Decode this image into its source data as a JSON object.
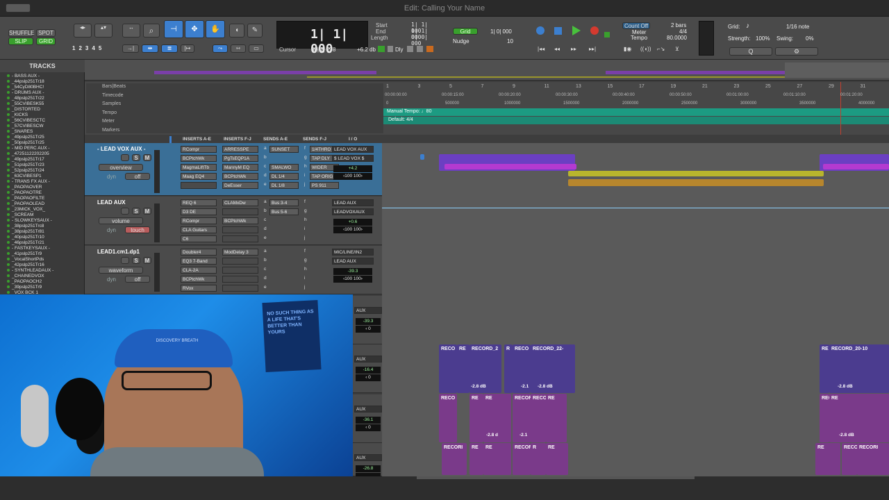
{
  "window": {
    "title": "Edit: Calling Your Name"
  },
  "toolbar": {
    "modes": [
      "SHUFFLE",
      "SPOT",
      "SLIP",
      "GRID"
    ],
    "zoom_presets": [
      "1",
      "2",
      "3",
      "4",
      "5"
    ],
    "main_counter": "1| 1| 000",
    "start_label": "Start",
    "end_label": "End",
    "length_label": "Length",
    "start": "1| 1| 000",
    "end": "1| 1| 000",
    "length": "0| 0| 000",
    "cursor_label": "Cursor",
    "cursor": "30| 2| 278",
    "cursor_db": "+6.2 db",
    "dly_label": "Dly",
    "grid_label": "Grid",
    "grid_value": "1| 0| 000",
    "nudge_label": "Nudge",
    "nudge_value": "10",
    "count_off": "Count Off",
    "meter_label": "Meter",
    "tempo_label": "Tempo",
    "bars": "2 bars",
    "meter_value": "4/4",
    "tempo_value": "80.0000",
    "grid_right_label": "Grid:",
    "grid_note": "1/16 note",
    "strength_label": "Strength:",
    "strength_value": "100%",
    "swing_label": "Swing:",
    "swing_value": "0%"
  },
  "tracks_list": {
    "header": "TRACKS",
    "items": [
      "- BASS AUX -",
      "_44pslp251Tr18",
      "_54CyD80BHC!",
      "- DRUMS AUX -",
      "_48pslp251Tr22",
      "_55CVIBESK55",
      "_DISTORTED",
      "_KICKS",
      "_56CVIBESCTC",
      "_57CVIBESCW",
      "_SNARES",
      "_49pslp251Tr25",
      "_50pslp251Tr25",
      "- MID PERC AUX -",
      "_47251122202205",
      "_49pslp251Tr17",
      "_51pslp251Tr23",
      "_52pslp251Tr24",
      "_63CVIBESP1",
      "- TRANS FX AUX -",
      "_PAOPAOVER",
      "_PAOPAOTRE",
      "_PAOPAOFILTE",
      "_PAOPAOLEAD",
      "_23MICK_VOX_",
      "_SCREAM",
      "- SLOWKEYSAUX -",
      "_38pslp251Trc8",
      "_38pslp251Tr81",
      "_40pslp251Tr10",
      "_46pslp251Tr21",
      "- FASTKEYSAUX -",
      "_41pslp251Tr9",
      "_VocalShortPds",
      "_42pslp251Tr16",
      "- SYNTHLEADAUX -",
      "_CHAINEDVOX",
      "_PAOPAOCH2",
      "_39pslp251Tr9",
      "_VOX BCK 1"
    ]
  },
  "rulers": {
    "labels": [
      "Bars|Beats",
      "Timecode",
      "Samples",
      "Tempo",
      "Meter",
      "Markers"
    ],
    "bars": [
      "1",
      "3",
      "5",
      "7",
      "9",
      "11",
      "13",
      "15",
      "17",
      "19",
      "21",
      "23",
      "25",
      "27",
      "29",
      "31",
      "33"
    ],
    "timecode": [
      "00:00:00:00",
      "00:00:15:00",
      "00:00:20:00",
      "00:00:30:00",
      "00:00:40:00",
      "00:00:50:00",
      "00:01:00:00",
      "00:01:10:00",
      "00:01:20:00",
      "00:01:30:00"
    ],
    "samples": [
      "0",
      "500000",
      "1000000",
      "1500000",
      "2000000",
      "2500000",
      "3000000",
      "3500000",
      "4000000"
    ],
    "tempo_marker": "Manual Tempo: ♩80",
    "meter_marker": "Default: 4/4"
  },
  "mix_header": [
    "INSERTS A-E",
    "INSERTS F-J",
    "SENDS A-E",
    "SENDS F-J",
    "I / O"
  ],
  "tracks": [
    {
      "name": "- LEAD VOX AUX -",
      "view": "overview",
      "auto": "off",
      "dyn": "dyn",
      "inserts_ae": [
        "RCompr",
        "BCPtchWk",
        "MagmaLiftTb",
        "Maag EQ4",
        ""
      ],
      "inserts_fj": [
        "ARRESSPE",
        "PgTsEQP1A",
        "MannyM EQ",
        "BCPtchWk",
        "DeEsser"
      ],
      "sends_ae": [
        "SUNSET",
        "",
        "SMALWO",
        "DL 1/4",
        "DL 1/8"
      ],
      "sends_fj": [
        "1/4THRO",
        "TAP DLY",
        "WIDER",
        "TAP ORIG",
        "PS 911"
      ],
      "io": [
        "LEAD VOX AUX",
        "$ LEAD VOX $"
      ],
      "vol": "vol",
      "vol_val": "+4.2",
      "pan": "‹100 100›"
    },
    {
      "name": "LEAD AUX",
      "view": "volume",
      "auto": "touch",
      "dyn": "dyn",
      "inserts_ae": [
        "REQ 6",
        "D3 DE",
        "RCompr",
        "CLA Guitars",
        "C6"
      ],
      "inserts_fj": [
        "CLAMxDw",
        "",
        "BCPtchWk",
        "",
        ""
      ],
      "sends_ae": [
        "Bus 3-4",
        "Bus 5-6",
        "",
        "",
        ""
      ],
      "sends_fj": [
        "",
        "",
        "",
        "",
        ""
      ],
      "io": [
        "LEAD AUX",
        "LEADVOXAUX"
      ],
      "vol": "vol",
      "vol_val": "+0.6",
      "pan": "‹100 100›"
    },
    {
      "name": "LEAD1.cm1.dp1",
      "view": "waveform",
      "auto": "off",
      "dyn": "dyn",
      "inserts_ae": [
        "Doubler4",
        "EQ3 7-Band",
        "CLA-2A",
        "BCPtchWk",
        "RVox"
      ],
      "inserts_fj": [
        "ModDelay 3",
        "",
        "",
        "",
        ""
      ],
      "sends_ae": [
        "",
        "",
        "",
        "",
        ""
      ],
      "sends_fj": [
        "",
        "",
        "",
        "",
        ""
      ],
      "io": [
        "MIC/LINE/IN2",
        "LEAD AUX"
      ],
      "vol": "vol",
      "vol_val": "-39.3",
      "pan": "‹100 100›"
    }
  ],
  "slot_letters_ae": [
    "a",
    "b",
    "c",
    "d",
    "e"
  ],
  "slot_letters_fj": [
    "f",
    "g",
    "h",
    "i",
    "j"
  ],
  "lower_tracks": [
    {
      "io": "AUX",
      "vol": "-39.3",
      "pan": "‹ 0"
    },
    {
      "io": "AUX",
      "vol": "-16.4",
      "pan": "‹ 0"
    },
    {
      "io": "AUX",
      "vol": "-36.1",
      "pan": "‹ 0"
    },
    {
      "io": "AUX",
      "vol": "-26.8",
      "pan": ""
    }
  ],
  "clips": {
    "row1": [
      "RECO",
      "RE",
      "RECORD_2",
      "R",
      "RECO",
      "RECORD_22-",
      "RE",
      "RECORD_20-10"
    ],
    "row1_gain": [
      "-2.8 dB",
      "-2.1",
      "-2.8 dB",
      "-2.8 dB"
    ],
    "row2": [
      "RECO",
      "RE",
      "RE",
      "RECOR",
      "RECO",
      "RE",
      "RECO",
      "RE",
      "RECORD_20-10"
    ],
    "row2_gain": [
      "-2.8 d",
      "-2.1",
      "-2.8 dB"
    ],
    "row3": [
      "RECORI",
      "RE",
      "RE",
      "RECOR",
      "R",
      "RE",
      "RE",
      "RECOR",
      "RECORI",
      "RE",
      "RECORD_4"
    ]
  },
  "webcam": {
    "poster_text": "NO SUCH THING AS A LIFE THAT'S BETTER THAN YOURS",
    "cap_text": "DISCOVERY BREATH"
  },
  "colors": {
    "accent_green": "#39a02d",
    "selected_blue": "#3c7fcf",
    "clip_purple": "#6b3fc2",
    "clip_magenta": "#b43ad0",
    "clip_olive": "#b8b52d",
    "clip_orange": "#b7862d",
    "tempo_teal": "#1c9b82"
  }
}
